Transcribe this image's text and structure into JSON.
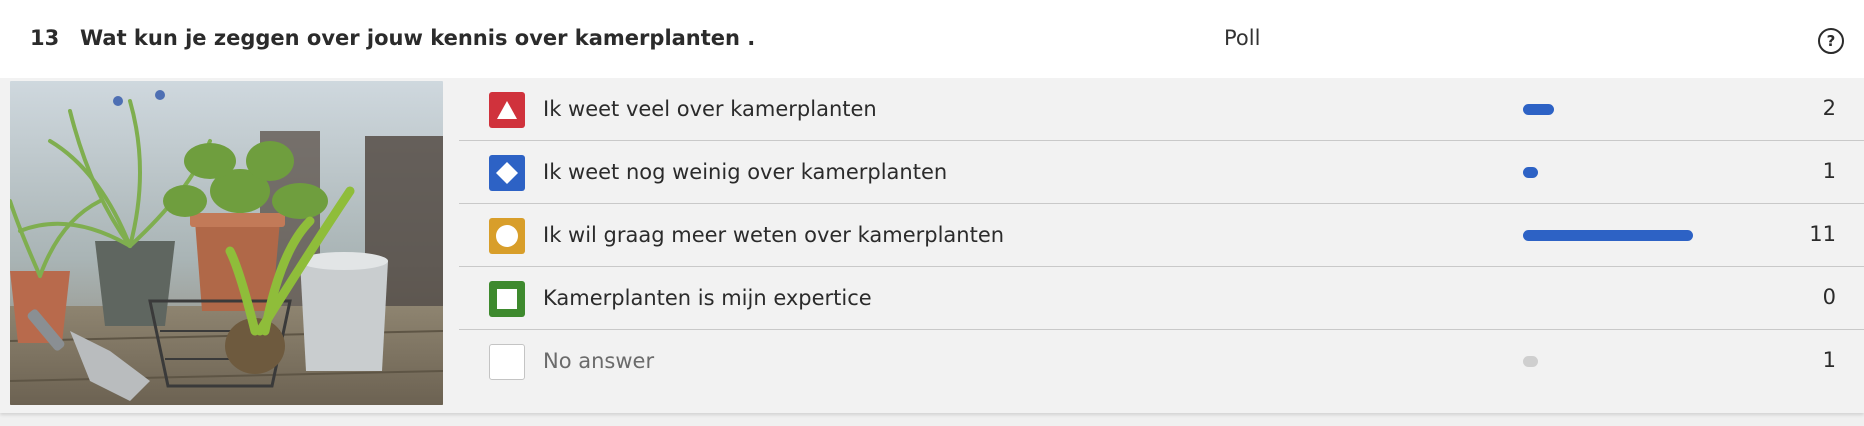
{
  "question": {
    "number": "13",
    "title": "Wat kun je zeggen over jouw kennis over kamerplanten .",
    "type": "Poll",
    "help_icon": "question-circle-icon"
  },
  "answers": [
    {
      "label": "Ik weet veel over kamerplanten",
      "count": "2",
      "share": 0.18,
      "shape": "triangle-icon",
      "color": "#d0323c",
      "bar_color": "#2d62c5"
    },
    {
      "label": "Ik weet nog weinig over kamerplanten",
      "count": "1",
      "share": 0.09,
      "shape": "diamond-icon",
      "color": "#2d62c5",
      "bar_color": "#2d62c5"
    },
    {
      "label": "Ik wil graag meer weten over kamerplanten",
      "count": "11",
      "share": 1.0,
      "shape": "circle-icon",
      "color": "#d89e2a",
      "bar_color": "#2d62c5"
    },
    {
      "label": "Kamerplanten is mijn expertice",
      "count": "0",
      "share": 0.0,
      "shape": "square-icon",
      "color": "#3e8a2e",
      "bar_color": "#2d62c5"
    },
    {
      "label": "No answer",
      "count": "1",
      "share": 0.09,
      "shape": "empty-box-icon",
      "color": "#ffffff",
      "bar_color": "#cfcfcf"
    }
  ],
  "colors": {
    "accent_bar": "#2d62c5",
    "no_answer_bar": "#cfcfcf"
  }
}
